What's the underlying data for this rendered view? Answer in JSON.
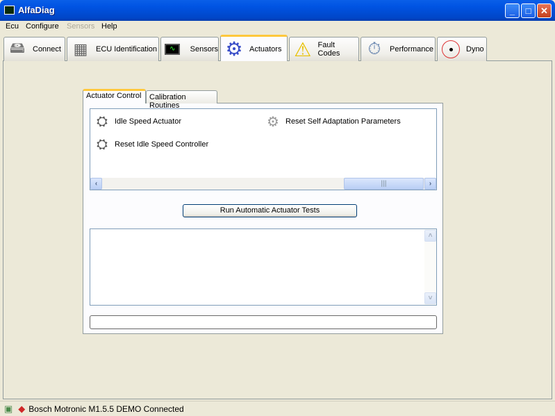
{
  "window": {
    "title": "AlfaDiag",
    "minimize": "_",
    "maximize": "□",
    "close": "✕"
  },
  "menu": [
    {
      "label": "Ecu",
      "enabled": true
    },
    {
      "label": "Configure",
      "enabled": true
    },
    {
      "label": "Sensors",
      "enabled": false
    },
    {
      "label": "Help",
      "enabled": true
    }
  ],
  "tabs": [
    {
      "label": "Connect",
      "icon": "hard-drive-network-icon"
    },
    {
      "label": "ECU Identification",
      "icon": "chip-icon"
    },
    {
      "label": "Sensors",
      "icon": "oscilloscope-icon"
    },
    {
      "label": "Actuators",
      "icon": "gear-icon",
      "selected": true
    },
    {
      "label": "Fault Codes",
      "icon": "warning-icon"
    },
    {
      "label": "Performance",
      "icon": "stopwatch-icon"
    },
    {
      "label": "Dyno",
      "icon": "gauge-icon"
    }
  ],
  "subtabs": [
    {
      "label": "Actuator Control",
      "selected": true
    },
    {
      "label": "Calibration Routines"
    }
  ],
  "actuators": [
    {
      "label": "Idle Speed Actuator",
      "icon": "throttle-body-icon"
    },
    {
      "label": "Reset Idle Speed Controller",
      "icon": "throttle-body-icon"
    },
    {
      "label": "Reset Self Adaptation Parameters",
      "icon": "parts-icon"
    }
  ],
  "run_button": "Run Automatic Actuator Tests",
  "output_text": "",
  "progress": 0,
  "status": {
    "text": "Bosch Motronic M1.5.5 DEMO Connected"
  }
}
